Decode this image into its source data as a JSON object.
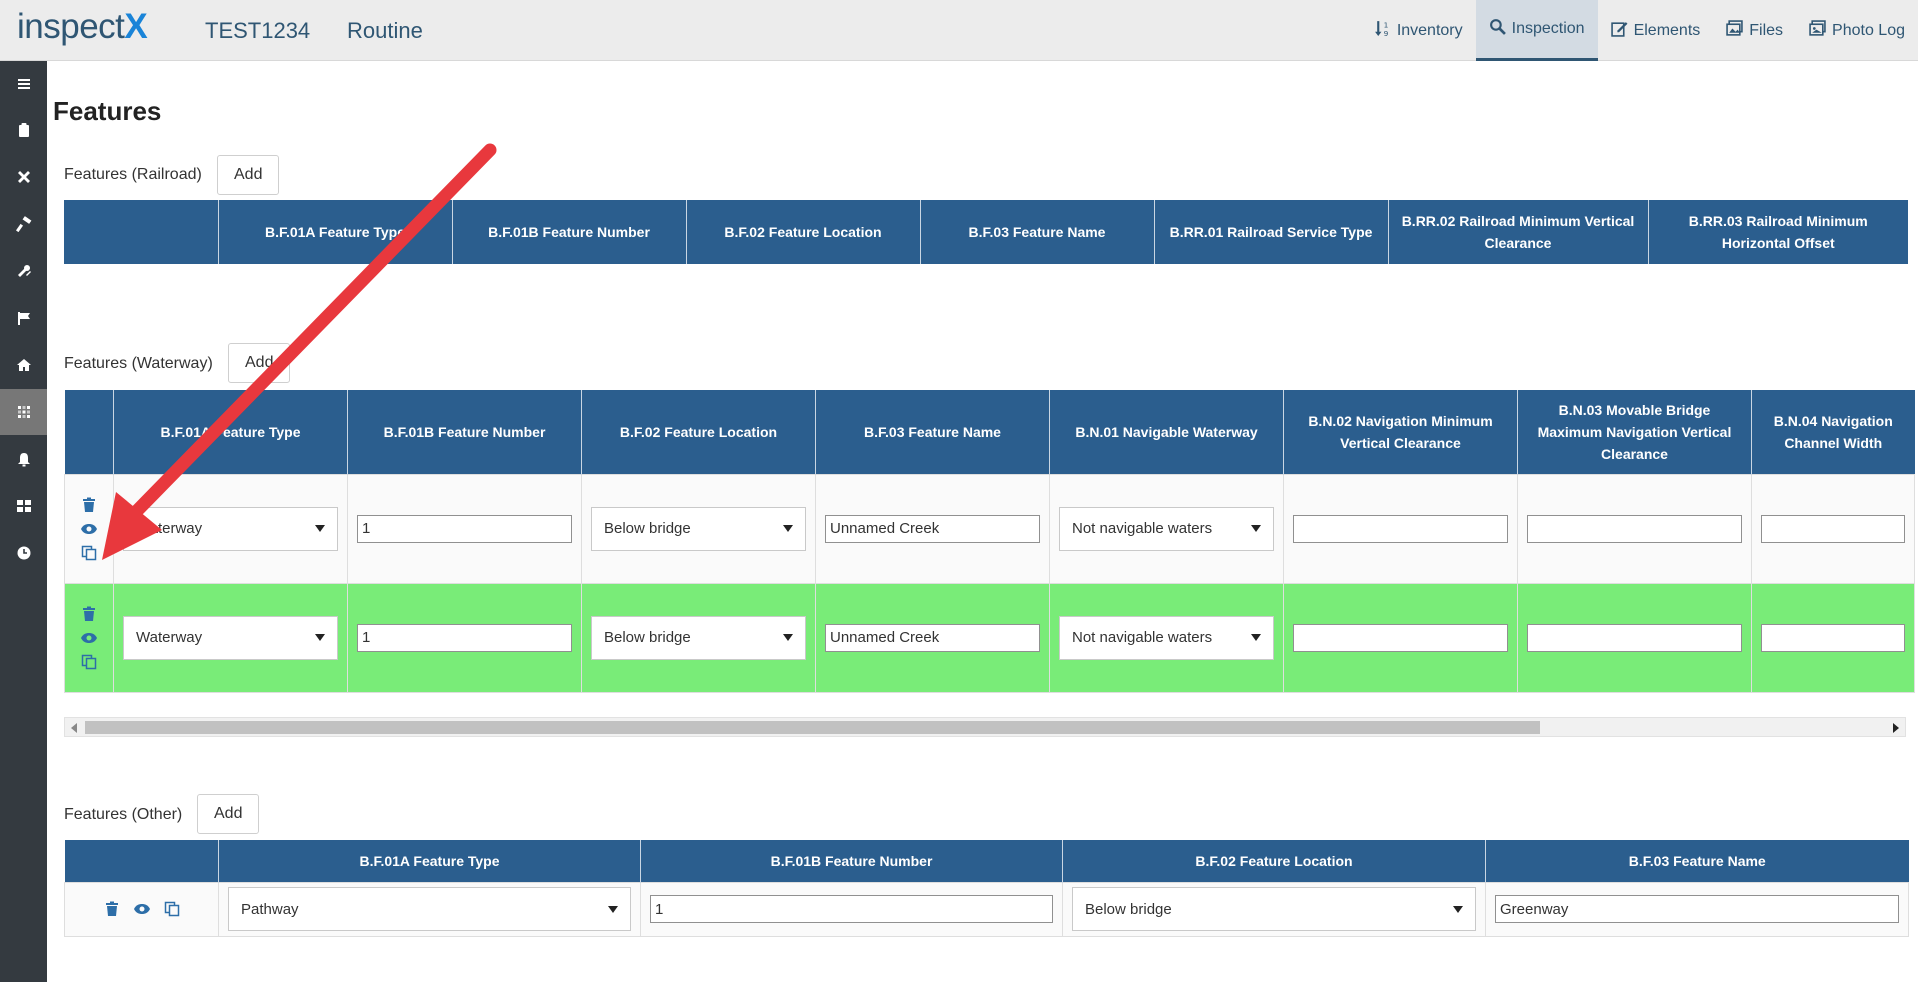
{
  "header": {
    "logo_text": "inspect",
    "logo_accent": "X",
    "structure_id": "TEST1234",
    "inspection_type": "Routine",
    "nav": [
      {
        "label": "Inventory",
        "icon": "sort-numeric-icon"
      },
      {
        "label": "Inspection",
        "icon": "search-icon",
        "active": true
      },
      {
        "label": "Elements",
        "icon": "edit-icon"
      },
      {
        "label": "Files",
        "icon": "images-icon"
      },
      {
        "label": "Photo Log",
        "icon": "photo-icon"
      }
    ]
  },
  "sidebar": {
    "icons": [
      "menu-icon",
      "clipboard-icon",
      "tools-icon",
      "hammer-icon",
      "wrench-icon",
      "flag-icon",
      "home-icon",
      "grid-pattern-icon",
      "bell-icon",
      "dashboard-icon",
      "clock-icon"
    ],
    "active_index": 7
  },
  "page": {
    "title": "Features"
  },
  "railroad": {
    "label": "Features (Railroad)",
    "add_label": "Add",
    "columns": [
      "",
      "B.F.01A Feature Type",
      "B.F.01B Feature Number",
      "B.F.02 Feature Location",
      "B.F.03 Feature Name",
      "B.RR.01 Railroad Service Type",
      "B.RR.02 Railroad Minimum Vertical Clearance",
      "B.RR.03 Railroad Minimum Horizontal Offset"
    ]
  },
  "waterway": {
    "label": "Features (Waterway)",
    "add_label": "Add",
    "columns": [
      "",
      "B.F.01A Feature Type",
      "B.F.01B Feature Number",
      "B.F.02 Feature Location",
      "B.F.03 Feature Name",
      "B.N.01 Navigable Waterway",
      "B.N.02 Navigation Minimum Vertical Clearance",
      "B.N.03 Movable Bridge Maximum Navigation Vertical Clearance",
      "B.N.04 Navigation Channel Width"
    ],
    "rows": [
      {
        "feature_type": "Waterway",
        "feature_number": "1",
        "feature_location": "Below bridge",
        "feature_name": "Unnamed Creek",
        "navigable": "Not navigable waters",
        "min_vert": "",
        "movable_max": "",
        "channel_width": "",
        "highlight": false
      },
      {
        "feature_type": "Waterway",
        "feature_number": "1",
        "feature_location": "Below bridge",
        "feature_name": "Unnamed Creek",
        "navigable": "Not navigable waters",
        "min_vert": "",
        "movable_max": "",
        "channel_width": "",
        "highlight": true
      }
    ]
  },
  "other": {
    "label": "Features (Other)",
    "add_label": "Add",
    "columns": [
      "",
      "B.F.01A Feature Type",
      "B.F.01B Feature Number",
      "B.F.02 Feature Location",
      "B.F.03 Feature Name"
    ],
    "rows": [
      {
        "feature_type": "Pathway",
        "feature_number": "1",
        "feature_location": "Below bridge",
        "feature_name": "Greenway"
      }
    ]
  },
  "colors": {
    "header_blue": "#2b5e8e",
    "new_row_green": "#79ec78",
    "annotation_arrow": "#e8383d",
    "sidebar_bg": "#343a40"
  }
}
